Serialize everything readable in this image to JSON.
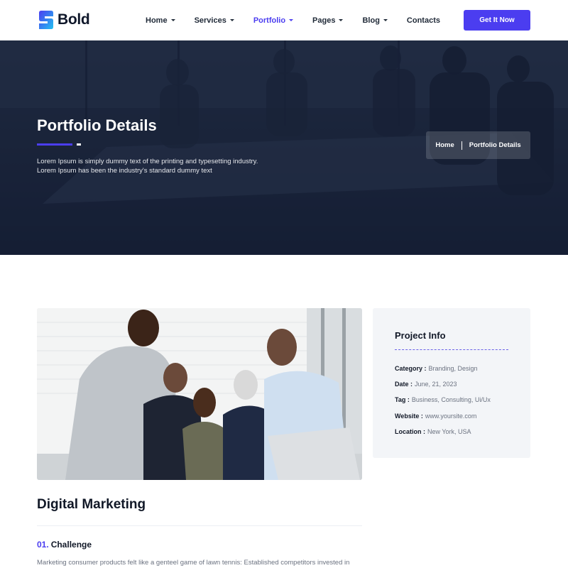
{
  "brand": {
    "name": "Bold",
    "accent": "#4b3df0",
    "logo_gradient": [
      "#4b3df0",
      "#22c1f1"
    ]
  },
  "nav": {
    "items": [
      {
        "label": "Home",
        "has_dropdown": true,
        "active": false
      },
      {
        "label": "Services",
        "has_dropdown": true,
        "active": false
      },
      {
        "label": "Portfolio",
        "has_dropdown": true,
        "active": true
      },
      {
        "label": "Pages",
        "has_dropdown": true,
        "active": false
      },
      {
        "label": "Blog",
        "has_dropdown": true,
        "active": false
      },
      {
        "label": "Contacts",
        "has_dropdown": false,
        "active": false
      }
    ],
    "cta_label": "Get It Now"
  },
  "hero": {
    "title": "Portfolio Details",
    "description_line1": "Lorem Ipsum is simply dummy text of the printing and typesetting industry.",
    "description_line2": "Lorem Ipsum has been the industry's standard dummy text",
    "breadcrumb": {
      "home": "Home",
      "current": "Portfolio Details"
    }
  },
  "project_info": {
    "title": "Project Info",
    "rows": [
      {
        "label": "Category :",
        "value": "Branding, Design"
      },
      {
        "label": "Date :",
        "value": "June, 21, 2023"
      },
      {
        "label": "Tag :",
        "value": "Business, Consulting, Ui/Ux"
      },
      {
        "label": "Website :",
        "value": "www.yoursite.com"
      },
      {
        "label": "Location :",
        "value": "New York, USA"
      }
    ]
  },
  "content": {
    "title": "Digital Marketing",
    "challenge_number": "01.",
    "challenge_title": "Challenge",
    "body_text": "Marketing consumer products felt like a genteel game of lawn tennis: Established competitors invested in"
  }
}
